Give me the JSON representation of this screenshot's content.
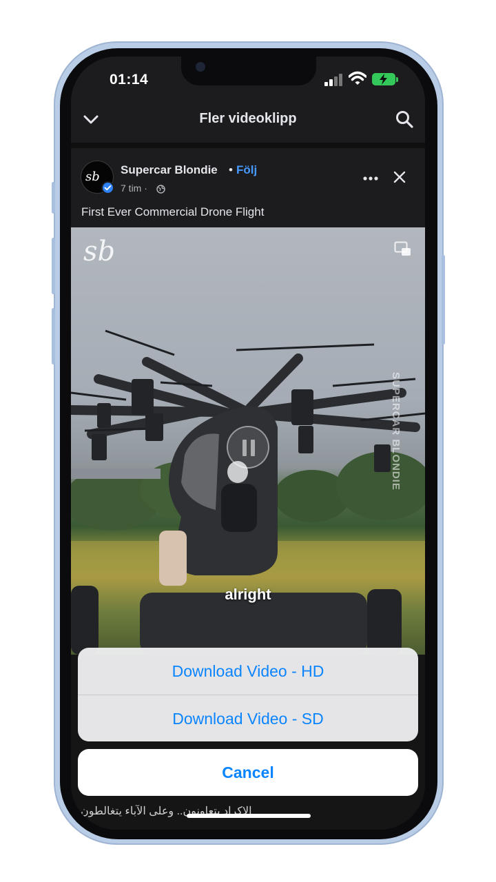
{
  "status_bar": {
    "time": "01:14"
  },
  "nav": {
    "title": "Fler videoklipp",
    "back_icon": "chevron-down-icon",
    "search_icon": "search-icon"
  },
  "post": {
    "avatar_text": "sb",
    "author": "Supercar Blondie",
    "separator": "•",
    "follow_label": "Följ",
    "time_ago": "7 tim ·",
    "privacy_icon": "globe-icon",
    "caption": "First Ever Commercial Drone Flight"
  },
  "video": {
    "watermark_logo": "sb",
    "side_watermark": "SUPERCAR BLONDIE",
    "subtitle": "alright",
    "playback_state": "paused-controls-visible"
  },
  "action_sheet": {
    "options": [
      "Download Video - HD",
      "Download Video - SD"
    ],
    "cancel_label": "Cancel"
  },
  "background_text": "الاكراد يتعاونون.. وعلى الآباء يتغالطون",
  "colors": {
    "accent": "#0a84ff",
    "follow": "#4599ff",
    "battery": "#34c759",
    "verified": "#2e81f3"
  }
}
